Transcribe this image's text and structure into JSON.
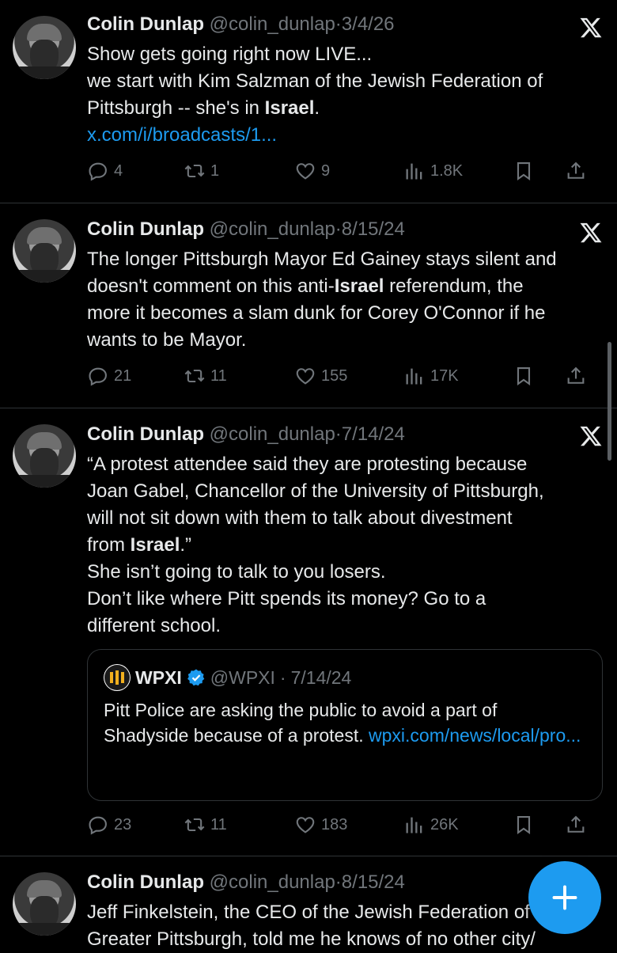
{
  "tweets": [
    {
      "name": "Colin Dunlap",
      "handle": "@colin_dunlap",
      "sep": "·",
      "date": "3/4/26",
      "lines": [
        "Show gets going right now LIVE...",
        "we start with Kim Salzman of the Jewish Federation of",
        "Pittsburgh -- she's in "
      ],
      "bold": "Israel",
      "after_bold": ".",
      "link": "x.com/i/broadcasts/1...",
      "replies": "4",
      "reposts": "1",
      "likes": "9",
      "views": "1.8K"
    },
    {
      "name": "Colin Dunlap",
      "handle": "@colin_dunlap",
      "sep": "·",
      "date": "8/15/24",
      "line1": "The longer Pittsburgh Mayor Ed Gainey stays silent and",
      "line2_pre": "doesn't comment on this anti-",
      "bold": "Israel",
      "line2_post": " referendum, the",
      "line3": "more it becomes a slam dunk for Corey O'Connor if he",
      "line4": "wants to be Mayor.",
      "replies": "21",
      "reposts": "11",
      "likes": "155",
      "views": "17K"
    },
    {
      "name": "Colin Dunlap",
      "handle": "@colin_dunlap",
      "sep": "·",
      "date": "7/14/24",
      "line1": "“A protest attendee said they are protesting because",
      "line2": "Joan Gabel, Chancellor of the University of Pittsburgh,",
      "line3": "will not sit down with them to talk about divestment",
      "line4_pre": "from ",
      "bold": "Israel",
      "line4_post": ".”",
      "line5": "She isn’t going to talk to you losers.",
      "line6": "Don’t like where Pitt spends its money? Go to a",
      "line7": "different school.",
      "quote": {
        "name": "WPXI",
        "handle": "@WPXI",
        "sep": "·",
        "date": "7/14/24",
        "text": "Pitt Police are asking the public to avoid a part of Shadyside because of a protest. ",
        "link": "wpxi.com/news/local/pro..."
      },
      "replies": "23",
      "reposts": "11",
      "likes": "183",
      "views": "26K"
    },
    {
      "name": "Colin Dunlap",
      "handle": "@colin_dunlap",
      "sep": "·",
      "date": "8/15/24",
      "line1": "Jeff Finkelstein, the CEO of the Jewish Federation of",
      "line2": "Greater Pittsburgh, told me he knows of no other city/"
    }
  ],
  "colors": {
    "accent": "#1d9bf0",
    "muted": "#71767b",
    "text": "#e7e9ea",
    "bg": "#000000"
  },
  "icons": [
    "x-logo-icon",
    "reply-icon",
    "repost-icon",
    "like-icon",
    "views-icon",
    "bookmark-icon",
    "share-icon",
    "verified-icon",
    "compose-plus-icon"
  ]
}
